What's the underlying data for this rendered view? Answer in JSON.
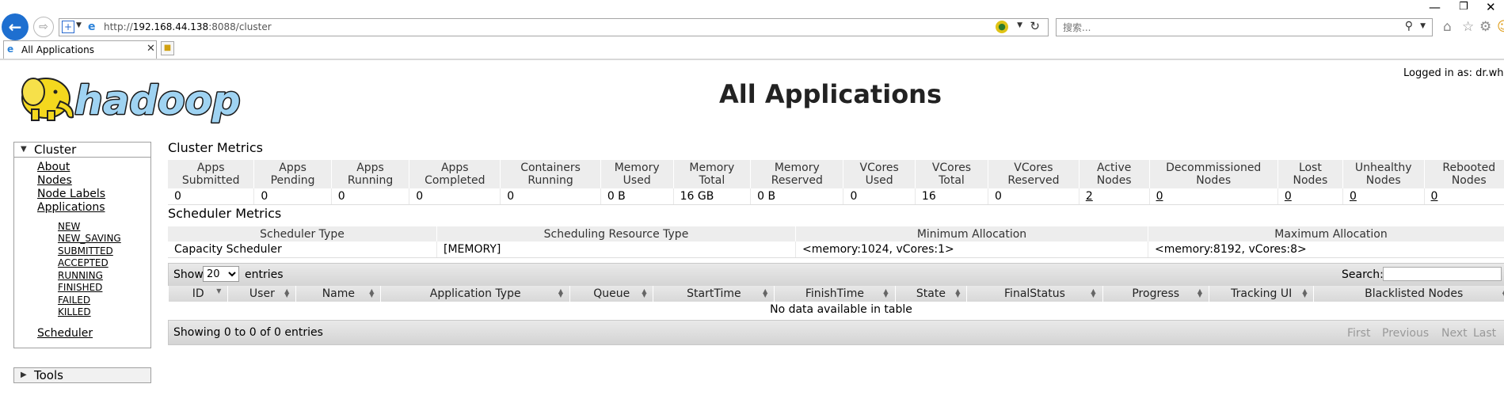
{
  "browser": {
    "url_prefix": "http://",
    "url_host": "192.168.44.138",
    "url_rest": ":8088/cluster",
    "search_placeholder": "搜索...",
    "tab_label": "All Applications"
  },
  "header": {
    "title": "All Applications",
    "logged_in": "Logged in as: dr.who"
  },
  "sidebar": {
    "cluster_label": "Cluster",
    "links": [
      "About",
      "Nodes",
      "Node Labels",
      "Applications"
    ],
    "states": [
      "NEW",
      "NEW_SAVING",
      "SUBMITTED",
      "ACCEPTED",
      "RUNNING",
      "FINISHED",
      "FAILED",
      "KILLED"
    ],
    "scheduler_label": "Scheduler",
    "tools_label": "Tools"
  },
  "cluster_metrics": {
    "title": "Cluster Metrics",
    "headers": [
      [
        "Apps",
        "Submitted"
      ],
      [
        "Apps",
        "Pending"
      ],
      [
        "Apps",
        "Running"
      ],
      [
        "Apps",
        "Completed"
      ],
      [
        "Containers",
        "Running"
      ],
      [
        "Memory",
        "Used"
      ],
      [
        "Memory",
        "Total"
      ],
      [
        "Memory",
        "Reserved"
      ],
      [
        "VCores",
        "Used"
      ],
      [
        "VCores",
        "Total"
      ],
      [
        "VCores",
        "Reserved"
      ],
      [
        "Active",
        "Nodes"
      ],
      [
        "Decommissioned",
        "Nodes"
      ],
      [
        "Lost",
        "Nodes"
      ],
      [
        "Unhealthy",
        "Nodes"
      ],
      [
        "Rebooted",
        "Nodes"
      ]
    ],
    "values": [
      "0",
      "0",
      "0",
      "0",
      "0",
      "0 B",
      "16 GB",
      "0 B",
      "0",
      "16",
      "0",
      "2",
      "0",
      "0",
      "0",
      "0"
    ]
  },
  "scheduler_metrics": {
    "title": "Scheduler Metrics",
    "headers": [
      "Scheduler Type",
      "Scheduling Resource Type",
      "Minimum Allocation",
      "Maximum Allocation"
    ],
    "values": [
      "Capacity Scheduler",
      "[MEMORY]",
      "<memory:1024, vCores:1>",
      "<memory:8192, vCores:8>"
    ]
  },
  "apps_table": {
    "show_label": "Show",
    "entries_value": "20",
    "entries_label": "entries",
    "search_label": "Search:",
    "headers": [
      "ID",
      "User",
      "Name",
      "Application Type",
      "Queue",
      "StartTime",
      "FinishTime",
      "State",
      "FinalStatus",
      "Progress",
      "Tracking UI",
      "Blacklisted Nodes"
    ],
    "empty_message": "No data available in table",
    "info": "Showing 0 to 0 of 0 entries",
    "pagination": [
      "First",
      "Previous",
      "Next",
      "Last"
    ]
  }
}
